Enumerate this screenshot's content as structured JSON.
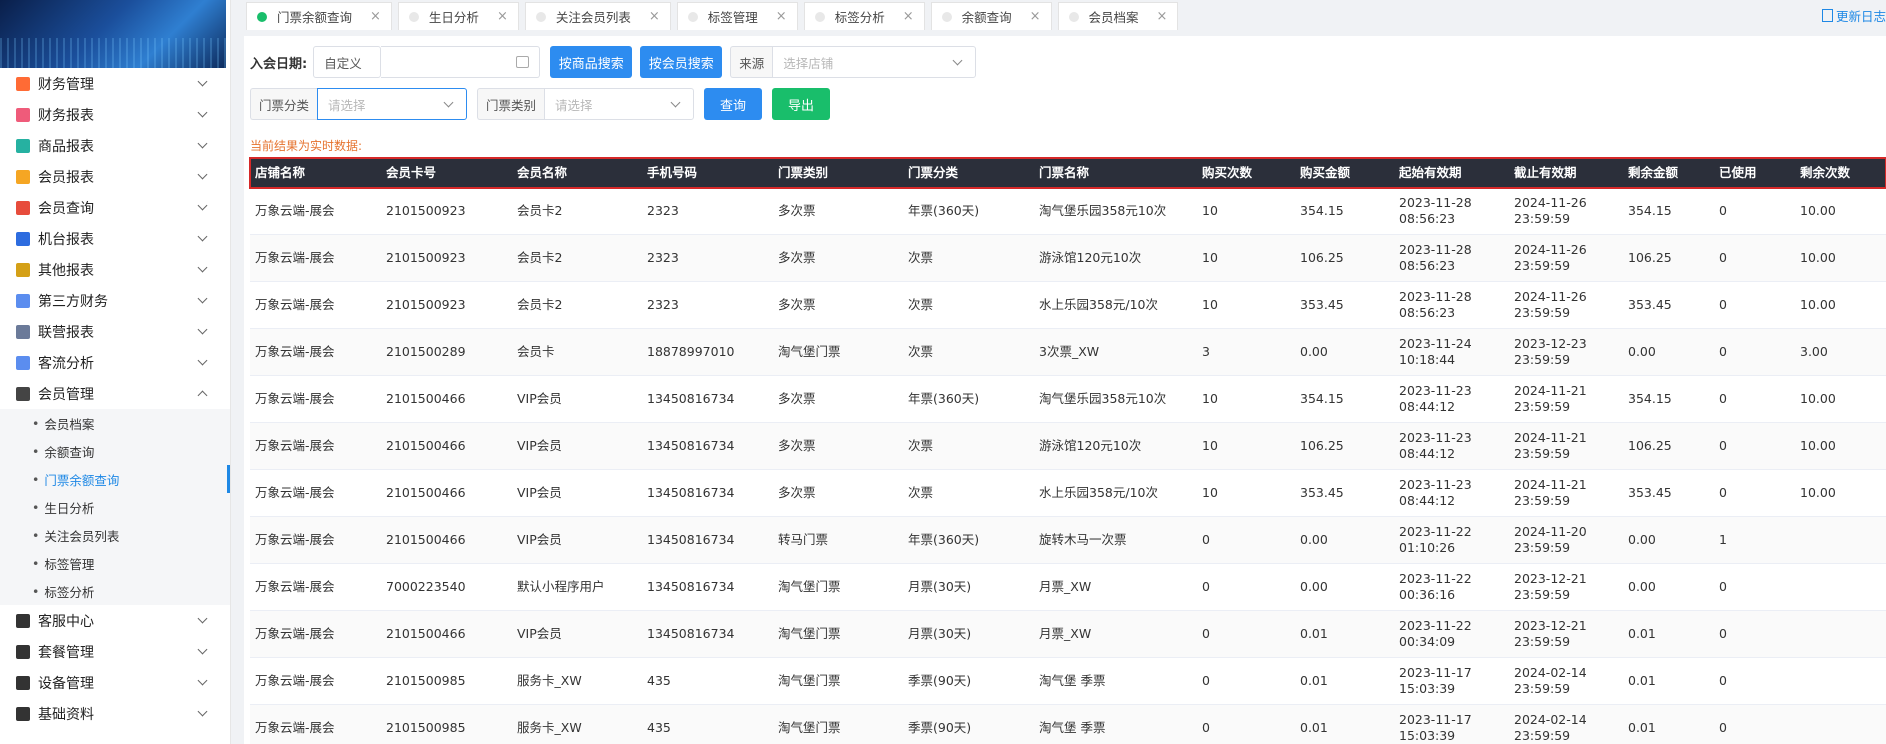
{
  "sidebar": {
    "menu": [
      {
        "label": "财务管理",
        "icon": "finance-icon",
        "color": "#ff6b35"
      },
      {
        "label": "财务报表",
        "icon": "finance-report-icon",
        "color": "#ef5b7a"
      },
      {
        "label": "商品报表",
        "icon": "goods-report-icon",
        "color": "#26b1a1"
      },
      {
        "label": "会员报表",
        "icon": "member-report-icon",
        "color": "#f5a623"
      },
      {
        "label": "会员查询",
        "icon": "member-query-icon",
        "color": "#e74c3c"
      },
      {
        "label": "机台报表",
        "icon": "machine-report-icon",
        "color": "#2d6cdf"
      },
      {
        "label": "其他报表",
        "icon": "other-report-icon",
        "color": "#d4a017"
      },
      {
        "label": "第三方财务",
        "icon": "third-party-icon",
        "color": "#5b8def"
      },
      {
        "label": "联营报表",
        "icon": "joint-report-icon",
        "color": "#6b7a99"
      },
      {
        "label": "客流分析",
        "icon": "traffic-icon",
        "color": "#5b8def"
      },
      {
        "label": "会员管理",
        "icon": "member-manage-icon",
        "color": "#444444"
      }
    ],
    "submenu": [
      {
        "label": "会员档案",
        "active": false
      },
      {
        "label": "余额查询",
        "active": false
      },
      {
        "label": "门票余额查询",
        "active": true
      },
      {
        "label": "生日分析",
        "active": false
      },
      {
        "label": "关注会员列表",
        "active": false
      },
      {
        "label": "标签管理",
        "active": false
      },
      {
        "label": "标签分析",
        "active": false
      }
    ],
    "menu_bottom": [
      {
        "label": "客服中心",
        "icon": "headset-icon",
        "color": "#333333"
      },
      {
        "label": "套餐管理",
        "icon": "package-icon",
        "color": "#333333"
      },
      {
        "label": "设备管理",
        "icon": "device-icon",
        "color": "#333333"
      },
      {
        "label": "基础资料",
        "icon": "basic-data-icon",
        "color": "#333333"
      }
    ]
  },
  "tabs": [
    {
      "label": "门票余额查询",
      "active": true
    },
    {
      "label": "生日分析",
      "active": false
    },
    {
      "label": "关注会员列表",
      "active": false
    },
    {
      "label": "标签管理",
      "active": false
    },
    {
      "label": "标签分析",
      "active": false
    },
    {
      "label": "余额查询",
      "active": false
    },
    {
      "label": "会员档案",
      "active": false
    }
  ],
  "update_label": "更新日志",
  "filters": {
    "join_date_label": "入会日期:",
    "date_mode": "自定义",
    "search_by_goods": "按商品搜索",
    "search_by_member": "按会员搜索",
    "source_label": "来源",
    "source_placeholder": "选择店铺",
    "ticket_category_label": "门票分类",
    "ticket_category_placeholder": "请选择",
    "ticket_type_label": "门票类别",
    "ticket_type_placeholder": "请选择",
    "query_button": "查询",
    "export_button": "导出"
  },
  "hint": "当前结果为实时数据:",
  "table": {
    "headers": [
      "店铺名称",
      "会员卡号",
      "会员名称",
      "手机号码",
      "门票类别",
      "门票分类",
      "门票名称",
      "购买次数",
      "购买金额",
      "起始有效期",
      "截止有效期",
      "剩余金额",
      "已使用",
      "剩余次数"
    ],
    "rows": [
      [
        "万象云端-展会",
        "2101500923",
        "会员卡2",
        "2323",
        "多次票",
        "年票(360天)",
        "淘气堡乐园358元10次",
        "10",
        "354.15",
        "2023-11-28|08:56:23",
        "2024-11-26|23:59:59",
        "354.15",
        "0",
        "10.00"
      ],
      [
        "万象云端-展会",
        "2101500923",
        "会员卡2",
        "2323",
        "多次票",
        "次票",
        "游泳馆120元10次",
        "10",
        "106.25",
        "2023-11-28|08:56:23",
        "2024-11-26|23:59:59",
        "106.25",
        "0",
        "10.00"
      ],
      [
        "万象云端-展会",
        "2101500923",
        "会员卡2",
        "2323",
        "多次票",
        "次票",
        "水上乐园358元/10次",
        "10",
        "353.45",
        "2023-11-28|08:56:23",
        "2024-11-26|23:59:59",
        "353.45",
        "0",
        "10.00"
      ],
      [
        "万象云端-展会",
        "2101500289",
        "会员卡",
        "18878997010",
        "淘气堡门票",
        "次票",
        "3次票_XW",
        "3",
        "0.00",
        "2023-11-24|10:18:44",
        "2023-12-23|23:59:59",
        "0.00",
        "0",
        "3.00"
      ],
      [
        "万象云端-展会",
        "2101500466",
        "VIP会员",
        "13450816734",
        "多次票",
        "年票(360天)",
        "淘气堡乐园358元10次",
        "10",
        "354.15",
        "2023-11-23|08:44:12",
        "2024-11-21|23:59:59",
        "354.15",
        "0",
        "10.00"
      ],
      [
        "万象云端-展会",
        "2101500466",
        "VIP会员",
        "13450816734",
        "多次票",
        "次票",
        "游泳馆120元10次",
        "10",
        "106.25",
        "2023-11-23|08:44:12",
        "2024-11-21|23:59:59",
        "106.25",
        "0",
        "10.00"
      ],
      [
        "万象云端-展会",
        "2101500466",
        "VIP会员",
        "13450816734",
        "多次票",
        "次票",
        "水上乐园358元/10次",
        "10",
        "353.45",
        "2023-11-23|08:44:12",
        "2024-11-21|23:59:59",
        "353.45",
        "0",
        "10.00"
      ],
      [
        "万象云端-展会",
        "2101500466",
        "VIP会员",
        "13450816734",
        "转马门票",
        "年票(360天)",
        "旋转木马一次票",
        "0",
        "0.00",
        "2023-11-22|01:10:26",
        "2024-11-20|23:59:59",
        "0.00",
        "1",
        ""
      ],
      [
        "万象云端-展会",
        "7000223540",
        "默认小程序用户",
        "13450816734",
        "淘气堡门票",
        "月票(30天)",
        "月票_XW",
        "0",
        "0.00",
        "2023-11-22|00:36:16",
        "2023-12-21|23:59:59",
        "0.00",
        "0",
        ""
      ],
      [
        "万象云端-展会",
        "2101500466",
        "VIP会员",
        "13450816734",
        "淘气堡门票",
        "月票(30天)",
        "月票_XW",
        "0",
        "0.01",
        "2023-11-22|00:34:09",
        "2023-12-21|23:59:59",
        "0.01",
        "0",
        ""
      ],
      [
        "万象云端-展会",
        "2101500985",
        "服务卡_XW",
        "435",
        "淘气堡门票",
        "季票(90天)",
        "淘气堡 季票",
        "0",
        "0.01",
        "2023-11-17|15:03:39",
        "2024-02-14|23:59:59",
        "0.01",
        "0",
        ""
      ],
      [
        "万象云端-展会",
        "2101500985",
        "服务卡_XW",
        "435",
        "淘气堡门票",
        "季票(90天)",
        "淘气堡 季票",
        "0",
        "0.01",
        "2023-11-17|15:03:39",
        "2024-02-14|23:59:59",
        "0.01",
        "0",
        ""
      ]
    ]
  }
}
